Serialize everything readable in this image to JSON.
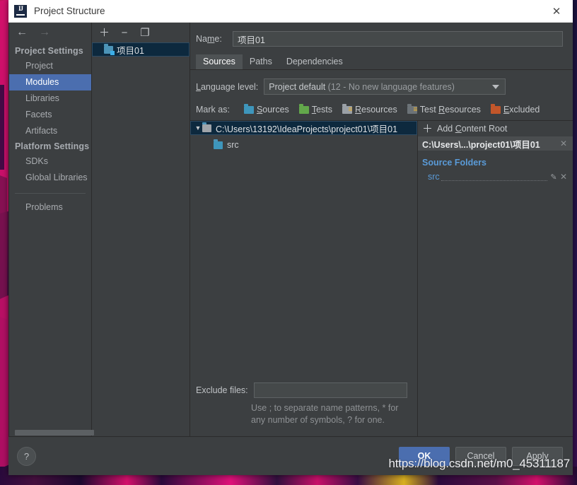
{
  "window": {
    "title": "Project Structure",
    "app_icon": "intellij-idea-icon",
    "close_label": "✕"
  },
  "nav": {
    "back_icon": "←",
    "forward_icon": "→"
  },
  "sidebar": {
    "groups": [
      {
        "label": "Project Settings",
        "items": [
          {
            "label": "Project",
            "selected": false
          },
          {
            "label": "Modules",
            "selected": true
          },
          {
            "label": "Libraries",
            "selected": false
          },
          {
            "label": "Facets",
            "selected": false
          },
          {
            "label": "Artifacts",
            "selected": false
          }
        ]
      },
      {
        "label": "Platform Settings",
        "items": [
          {
            "label": "SDKs",
            "selected": false
          },
          {
            "label": "Global Libraries",
            "selected": false
          }
        ]
      }
    ],
    "extra_items": [
      {
        "label": "Problems",
        "selected": false
      }
    ]
  },
  "modules_panel": {
    "toolbar": [
      {
        "name": "add-module-button",
        "glyph": "＋"
      },
      {
        "name": "remove-module-button",
        "glyph": "−"
      },
      {
        "name": "copy-module-button",
        "glyph": "❐"
      }
    ],
    "tree": [
      {
        "label": "项目01",
        "icon": "module-folder-icon",
        "selected": true
      }
    ]
  },
  "main": {
    "name_label_pre": "Na",
    "name_label_underline": "m",
    "name_label_post": "e:",
    "name_value": "项目01",
    "name_placeholder": "",
    "tabs": [
      {
        "label": "Sources",
        "active": true
      },
      {
        "label": "Paths",
        "active": false
      },
      {
        "label": "Dependencies",
        "active": false
      }
    ],
    "language_level": {
      "label_underline": "L",
      "label_rest": "anguage level:",
      "value_main": "Project default ",
      "value_dim": "(12 - No new language features)"
    },
    "mark_as": {
      "label": "Mark as:",
      "options": [
        {
          "label_pre": "",
          "label_underline": "S",
          "label_post": "ources",
          "color": "#3e96bc",
          "icon": "sources-folder-icon",
          "lines": false
        },
        {
          "label_pre": "",
          "label_underline": "T",
          "label_post": "ests",
          "color": "#62a74b",
          "icon": "tests-folder-icon",
          "lines": false
        },
        {
          "label_pre": "",
          "label_underline": "R",
          "label_post": "esources",
          "color": "#9aa0a6",
          "icon": "resources-folder-icon",
          "lines": true
        },
        {
          "label_pre": "Test ",
          "label_underline": "R",
          "label_post": "esources",
          "color": "#6c7378",
          "icon": "test-resources-folder-icon",
          "lines": true
        },
        {
          "label_pre": "",
          "label_underline": "E",
          "label_post": "xcluded",
          "color": "#c2562a",
          "icon": "excluded-folder-icon",
          "lines": false
        }
      ]
    },
    "content_tree": {
      "twisty": "▼",
      "root_label": "C:\\Users\\13192\\IdeaProjects\\project01\\项目01",
      "children": [
        {
          "label": "src",
          "icon": "source-folder-icon"
        }
      ]
    },
    "exclude": {
      "label": "Exclude files:",
      "value": "",
      "placeholder": "",
      "hint_line1": "Use ; to separate name patterns, * for",
      "hint_line2": "any number of symbols, ? for one."
    }
  },
  "right_panel": {
    "add_content_root": {
      "plus": "＋",
      "label_pre": "Add ",
      "label_underline": "C",
      "label_post": "ontent Root"
    },
    "content_root_entry": {
      "label": "C:\\Users\\...\\project01\\项目01",
      "remove_icon": "✕"
    },
    "source_folders_title": "Source Folders",
    "source_folders": [
      {
        "label": "src",
        "edit_icon": "✎",
        "remove_icon": "✕"
      }
    ]
  },
  "bottom": {
    "help_label": "?",
    "buttons": [
      {
        "label": "OK",
        "primary": true
      },
      {
        "label": "Cancel",
        "primary": false
      },
      {
        "label": "Apply",
        "primary": false
      }
    ]
  },
  "watermark": {
    "text": "https://blog.csdn.net/m0_45311187"
  },
  "colors": {
    "accent_blue": "#4b6eaf",
    "panel_bg": "#3c3f41",
    "selection_tree": "#0d293e",
    "link_blue": "#5a9bd8",
    "sources_color": "#3e96bc",
    "tests_color": "#62a74b",
    "resources_color": "#9aa0a6",
    "excluded_color": "#c2562a"
  }
}
